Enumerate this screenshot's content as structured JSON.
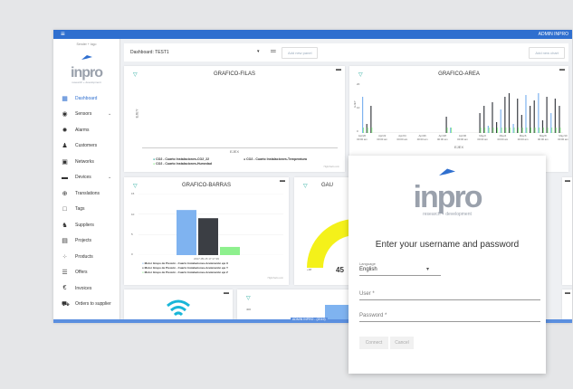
{
  "topbar": {
    "menu_icon": "menu-icon",
    "admin": "ADMIN INPRO"
  },
  "sidebar": {
    "sender": "Sender + logo",
    "logo_word": "inpro",
    "logo_tag": "research + development",
    "items": [
      {
        "label": "Dashboard",
        "icon": "dashboard-icon"
      },
      {
        "label": "Sensors",
        "icon": "sensor-icon"
      },
      {
        "label": "Alarms",
        "icon": "alarm-icon"
      },
      {
        "label": "Customers",
        "icon": "customers-icon"
      },
      {
        "label": "Networks",
        "icon": "network-icon"
      },
      {
        "label": "Devices",
        "icon": "devices-icon"
      },
      {
        "label": "Translations",
        "icon": "globe-icon"
      },
      {
        "label": "Tags",
        "icon": "tag-icon"
      },
      {
        "label": "Suppliers",
        "icon": "suppliers-icon"
      },
      {
        "label": "Projects",
        "icon": "projects-icon"
      },
      {
        "label": "Products",
        "icon": "products-icon"
      },
      {
        "label": "Offers",
        "icon": "offers-icon"
      },
      {
        "label": "Invoices",
        "icon": "euro-icon"
      },
      {
        "label": "Orders to supplier",
        "icon": "orders-icon"
      }
    ]
  },
  "toolbar": {
    "dashboard_label": "Dashboard: TEST1",
    "add_panel": "Add new panel",
    "add_chart": "Add new chart"
  },
  "cards": {
    "filas": {
      "title": "GRAFICO-FILAS",
      "ylabel": "EJEY",
      "xlabel": "EJEX",
      "legend": [
        "CO2 - Cuarto Instalaciones-CO2_22",
        "CO2 - Cuarto Instalaciones-Humedad",
        "CO2 - Cuarto Instalaciones-Temperatura"
      ],
      "credit": "Highcharts.com"
    },
    "area": {
      "title": "GRAFICO-AREA",
      "ylabel": "EJEY",
      "xlabel": "EJEX",
      "ticks_y": [
        "20",
        "10",
        "0"
      ],
      "ticks_x": [
        "Apr/20\n00:00 am",
        "Apr/22\n00:00 am",
        "Apr/24\n00:00 am",
        "Apr/26\n00:00 am",
        "Apr/28\n00:00 am",
        "Apr/30\n00:00 am",
        "May/2\n00:00 am",
        "May/4\n00:00 am",
        "May/6\n00:00 am",
        "May/8\n00:00 am",
        "May/10\n00:00 am"
      ]
    },
    "barras": {
      "title": "GRAFICO-BARRAS",
      "ticks_y": [
        "15",
        "10",
        "5",
        "0"
      ],
      "xcat": "2017-05-15 17:17:29",
      "legend": [
        "Motor Grupo de Presión - Cuarto Instalaciones-Aceleración eje X",
        "Motor Grupo de Presión - Cuarto Instalaciones-Aceleración eje Y",
        "Motor Grupo de Presión - Cuarto Instalaciones-Aceleración eje Z"
      ],
      "credit": "Highcharts.com"
    },
    "gauge": {
      "title": "GAU",
      "low": "+48",
      "value": "45"
    },
    "bottom": {
      "tick": "400"
    }
  },
  "chart_data": [
    {
      "type": "bar",
      "categories": [
        "2017-05-15 17:17:29"
      ],
      "ylim": [
        0,
        15
      ],
      "series": [
        {
          "name": "Motor Grupo de Presión - Cuarto Instalaciones-Aceleración eje X",
          "values": [
            11
          ],
          "color": "#7fb3f0"
        },
        {
          "name": "Motor Grupo de Presión - Cuarto Instalaciones-Aceleración eje Y",
          "values": [
            9
          ],
          "color": "#3b3e44"
        },
        {
          "name": "Motor Grupo de Presión - Cuarto Instalaciones-Aceleración eje Z",
          "values": [
            2
          ],
          "color": "#8ef08e"
        }
      ]
    }
  ],
  "footer": "ADMIN INPRO - (2019)",
  "login": {
    "logo_word": "inpro",
    "logo_tag": "research + development",
    "heading": "Enter your username and password",
    "language_label": "Language",
    "language_value": "English",
    "user_label": "User *",
    "password_label": "Password *",
    "connect": "Connect",
    "cancel": "Cancel"
  },
  "colors": {
    "primary": "#2f6fcf",
    "accent": "#20a89a",
    "gauge": "#f4f11a",
    "wifi": "#19b6d8"
  }
}
